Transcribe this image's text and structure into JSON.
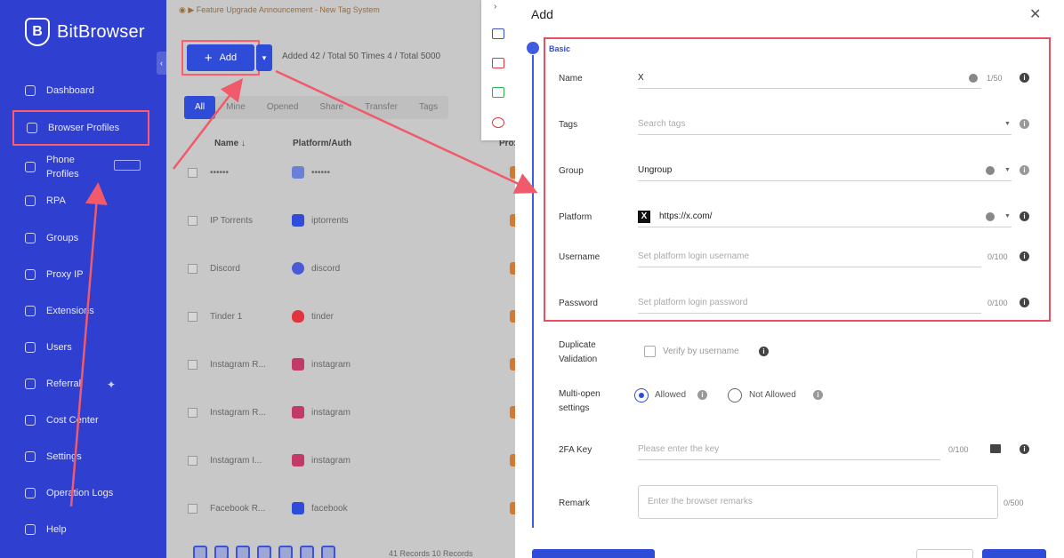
{
  "brand": {
    "name": "BitBrowser"
  },
  "sidebar": {
    "items": [
      {
        "label": "Dashboard",
        "icon": "dashboard-icon"
      },
      {
        "label": "Browser Profiles",
        "icon": "browser-icon",
        "active": true
      },
      {
        "label": "Phone\nProfiles",
        "icon": "phone-icon"
      },
      {
        "label": "RPA",
        "icon": "rpa-icon"
      },
      {
        "label": "Groups",
        "icon": "groups-icon"
      },
      {
        "label": "Proxy IP",
        "icon": "proxy-icon"
      },
      {
        "label": "Extensions",
        "icon": "extensions-icon"
      },
      {
        "label": "Users",
        "icon": "users-icon"
      },
      {
        "label": "Referral",
        "icon": "referral-icon"
      },
      {
        "label": "Cost Center",
        "icon": "cost-icon"
      },
      {
        "label": "Settings",
        "icon": "settings-icon"
      },
      {
        "label": "Operation Logs",
        "icon": "logs-icon"
      },
      {
        "label": "Help",
        "icon": "help-icon"
      }
    ]
  },
  "main": {
    "announcement": "Feature Upgrade Announcement - New Tag System",
    "add_label": "Add",
    "counts": "Added 42 / Total 50     Times 4 / Total 5000",
    "filter_tabs": [
      "All",
      "Mine",
      "Opened",
      "Share",
      "Transfer",
      "Tags"
    ],
    "columns": {
      "name": "Name ↓",
      "platform": "Platform/Auth",
      "proxy": "Prox"
    },
    "rows": [
      {
        "name": "••••••",
        "platform": "••••••",
        "color": "#6a7fd6"
      },
      {
        "name": "IP Torrents",
        "platform": "iptorrents",
        "color": "#2f4cd9"
      },
      {
        "name": "Discord",
        "platform": "discord",
        "color": "#4a5ad6"
      },
      {
        "name": "Tinder 1",
        "platform": "tinder",
        "color": "#e2363e"
      },
      {
        "name": "Instagram R...",
        "platform": "instagram",
        "color": "#c23a6a"
      },
      {
        "name": "Instagram R...",
        "platform": "instagram",
        "color": "#c23a6a"
      },
      {
        "name": "Instagram I...",
        "platform": "instagram",
        "color": "#c23a6a"
      },
      {
        "name": "Facebook R...",
        "platform": "facebook",
        "color": "#2f4cd9"
      }
    ],
    "records": "41 Records    10 Records"
  },
  "drawer": {
    "title": "Add",
    "section": "Basic",
    "fields": {
      "name": {
        "label": "Name",
        "value": "X",
        "counter": "1/50"
      },
      "tags": {
        "label": "Tags",
        "placeholder": "Search tags"
      },
      "group": {
        "label": "Group",
        "value": "Ungroup"
      },
      "platform": {
        "label": "Platform",
        "value": "https://x.com/"
      },
      "username": {
        "label": "Username",
        "placeholder": "Set platform login username",
        "counter": "0/100"
      },
      "password": {
        "label": "Password",
        "placeholder": "Set platform login password",
        "counter": "0/100"
      },
      "duplicate": {
        "label": "Duplicate\nValidation",
        "option": "Verify by username"
      },
      "multiopen": {
        "label": "Multi-open\nsettings",
        "allowed": "Allowed",
        "not_allowed": "Not Allowed"
      },
      "twofa": {
        "label": "2FA Key",
        "placeholder": "Please enter the key",
        "counter": "0/100"
      },
      "remark": {
        "label": "Remark",
        "placeholder": "Enter the browser remarks",
        "counter": "0/500"
      }
    }
  },
  "colors": {
    "brand": "#2f3fd0",
    "accent": "#2f4cd9",
    "highlight": "#e8505f"
  }
}
